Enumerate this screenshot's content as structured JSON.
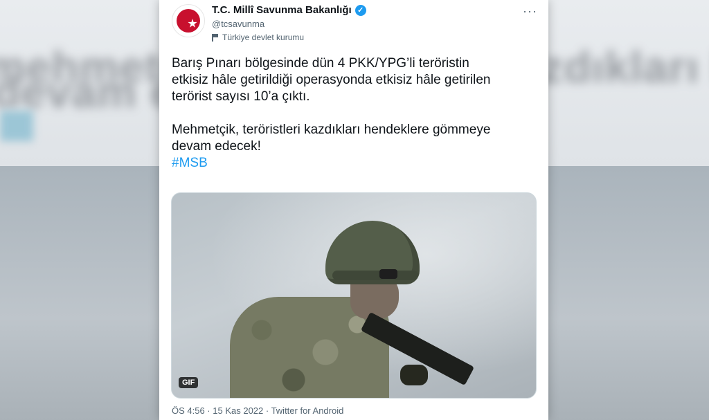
{
  "background": {
    "line1": "mehmetçik, teröristleri kazdıkları hendeklere gömmeye",
    "line2": "devam edecek!"
  },
  "tweet": {
    "author_name": "T.C. Millî Savunma Bakanlığı",
    "handle": "@tcsavunma",
    "account_label": "Türkiye devlet kurumu",
    "paragraph1": "Barış Pınarı bölgesinde dün 4 PKK/YPG’li teröristin\netkisiz hâle getirildiği operasyonda etkisiz hâle getirilen\nterörist sayısı 10’a çıktı.",
    "paragraph2": "Mehmetçik, teröristleri kazdıkları hendeklere gömmeye\ndevam edecek!",
    "hashtag": "#MSB",
    "media_badge": "GIF",
    "timestamp": "ÖS 4:56 · 15 Kas 2022 · Twitter for Android"
  },
  "colors": {
    "link": "#1d9bf0",
    "verified": "#1d9bf0",
    "avatar_red": "#c8102e"
  },
  "icons": [
    "more-options-icon",
    "verified-badge-icon",
    "flag-icon"
  ]
}
